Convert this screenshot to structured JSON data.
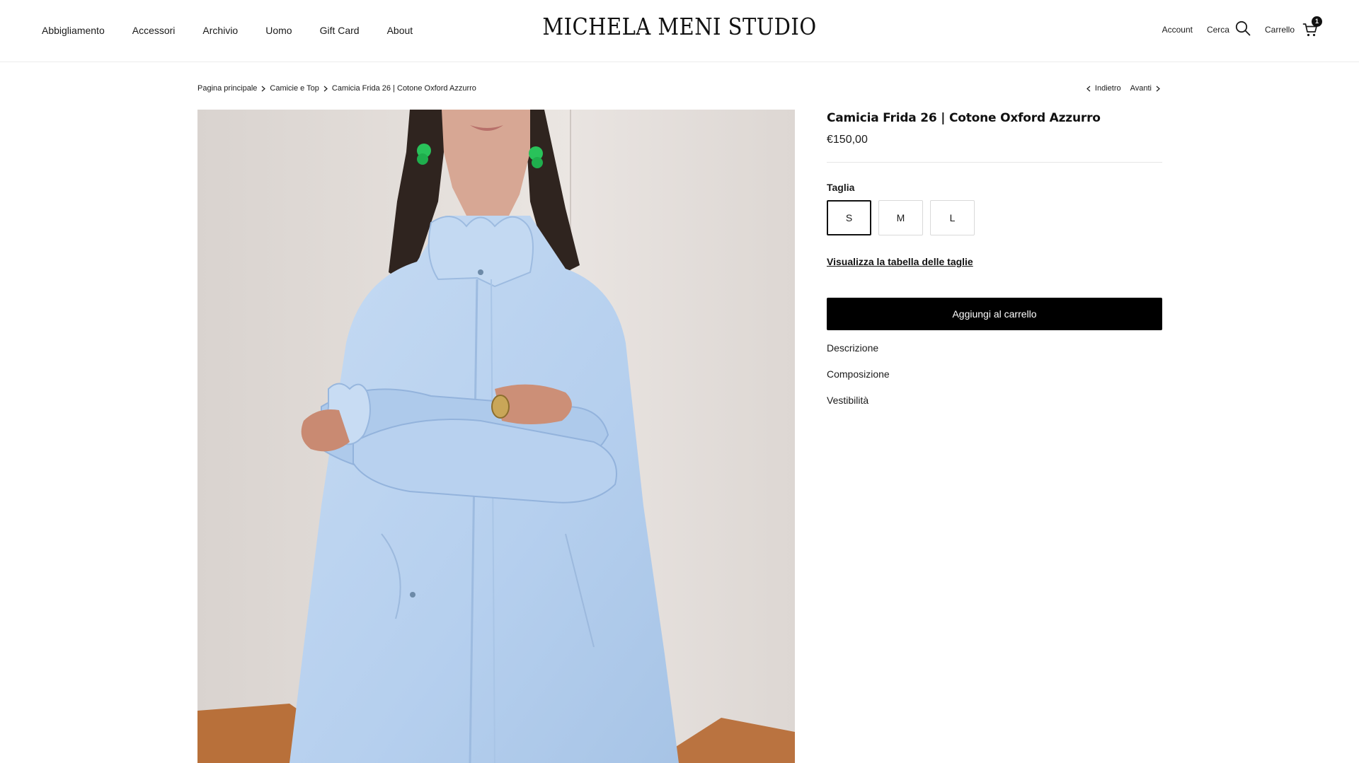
{
  "header": {
    "nav": [
      "Abbigliamento",
      "Accessori",
      "Archivio",
      "Uomo",
      "Gift Card",
      "About"
    ],
    "logo": "MICHELA MENI STUDIO",
    "account_label": "Account",
    "search_label": "Cerca",
    "cart_label": "Carrello",
    "cart_count": "1",
    "icons": {
      "search": "search-icon",
      "cart": "cart-icon"
    }
  },
  "breadcrumb": {
    "items": [
      "Pagina principale",
      "Camicie e Top",
      "Camicia Frida 26 | Cotone Oxford Azzurro"
    ]
  },
  "pager": {
    "prev": "Indietro",
    "next": "Avanti"
  },
  "product": {
    "title": "Camicia Frida 26 | Cotone Oxford Azzurro",
    "price": "€150,00",
    "option_label": "Taglia",
    "sizes": [
      "S",
      "M",
      "L"
    ],
    "selected_size": "S",
    "size_guide": "Visualizza la tabella delle taglie",
    "add_to_cart": "Aggiungi al carrello",
    "accordion": [
      "Descrizione",
      "Composizione",
      "Vestibilità"
    ]
  },
  "colors": {
    "accent": "#000000",
    "shirt": "#b9d3ef",
    "background": "#ffffff"
  }
}
